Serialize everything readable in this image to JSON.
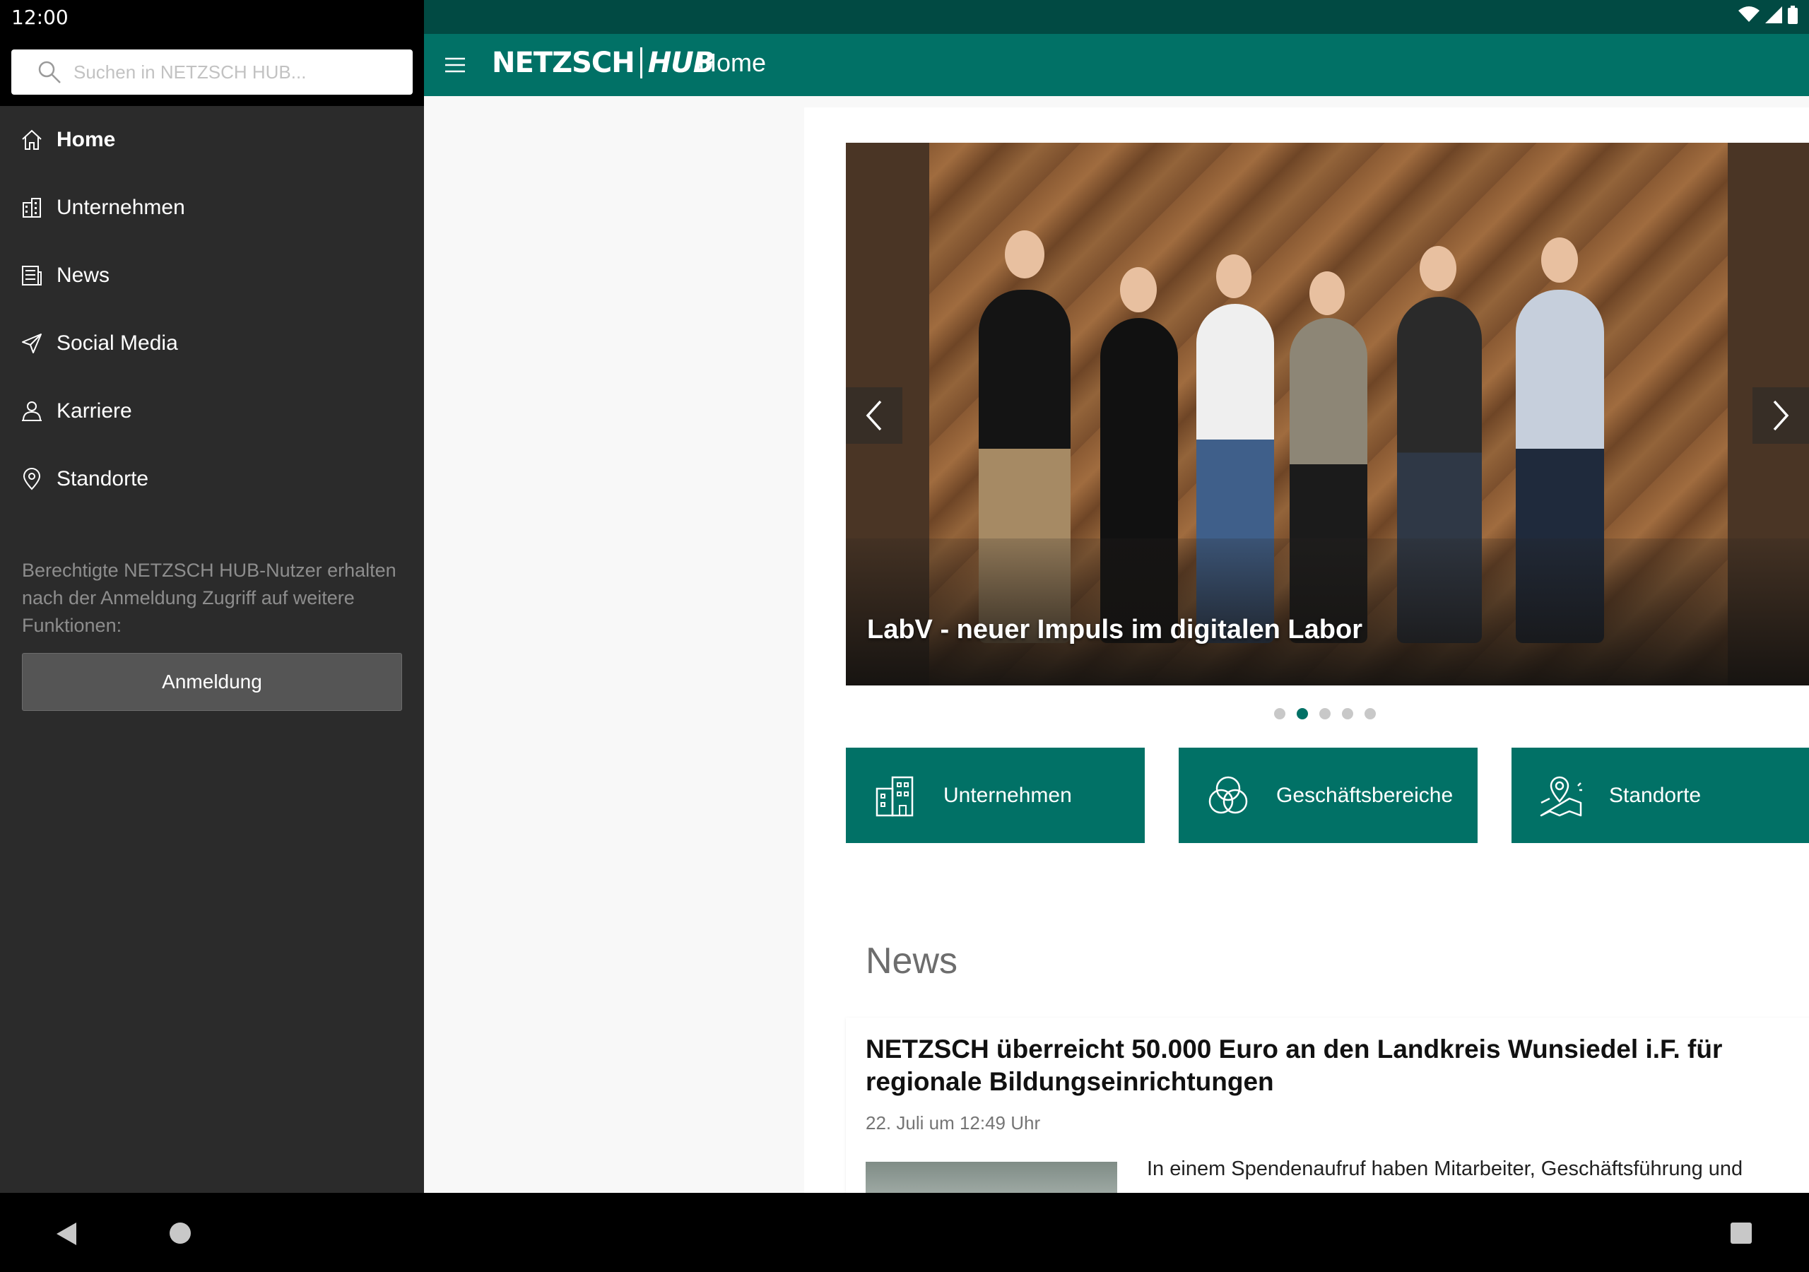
{
  "status_bar": {
    "time": "12:00"
  },
  "drawer": {
    "search_placeholder": "Suchen in NETZSCH HUB...",
    "items": [
      {
        "label": "Home",
        "icon": "home-icon",
        "active": true
      },
      {
        "label": "Unternehmen",
        "icon": "building-icon",
        "active": false
      },
      {
        "label": "News",
        "icon": "newspaper-icon",
        "active": false
      },
      {
        "label": "Social Media",
        "icon": "send-icon",
        "active": false
      },
      {
        "label": "Karriere",
        "icon": "career-icon",
        "active": false
      },
      {
        "label": "Standorte",
        "icon": "location-pin-icon",
        "active": false
      }
    ],
    "note": "Berechtigte NETZSCH HUB-Nutzer erhalten nach der Anmeldung Zugriff auf weitere Funktionen:",
    "login_label": "Anmeldung"
  },
  "app_bar": {
    "logo_brand": "NETZSCH",
    "logo_hub": "HUB",
    "title": "Home"
  },
  "carousel": {
    "caption": "LabV - neuer Impuls im digitalen Labor",
    "slide_count": 5,
    "active_index": 1
  },
  "tiles": [
    {
      "label": "Unternehmen",
      "icon": "building-icon"
    },
    {
      "label": "Geschäftsbereiche",
      "icon": "venn-circles-icon"
    },
    {
      "label": "Standorte",
      "icon": "map-pin-icon"
    }
  ],
  "news": {
    "heading": "News",
    "items": [
      {
        "title": "NETZSCH überreicht 50.000 Euro an den Landkreis Wunsiedel i.F. für regionale Bildungseinrichtungen",
        "date": "22. Juli um 12:49 Uhr",
        "excerpt": "In einem Spendenaufruf haben Mitarbeiter, Geschäftsführung und"
      }
    ]
  },
  "colors": {
    "brand_teal": "#017166",
    "status_teal": "#014a43",
    "drawer_bg": "#2b2b2b"
  }
}
